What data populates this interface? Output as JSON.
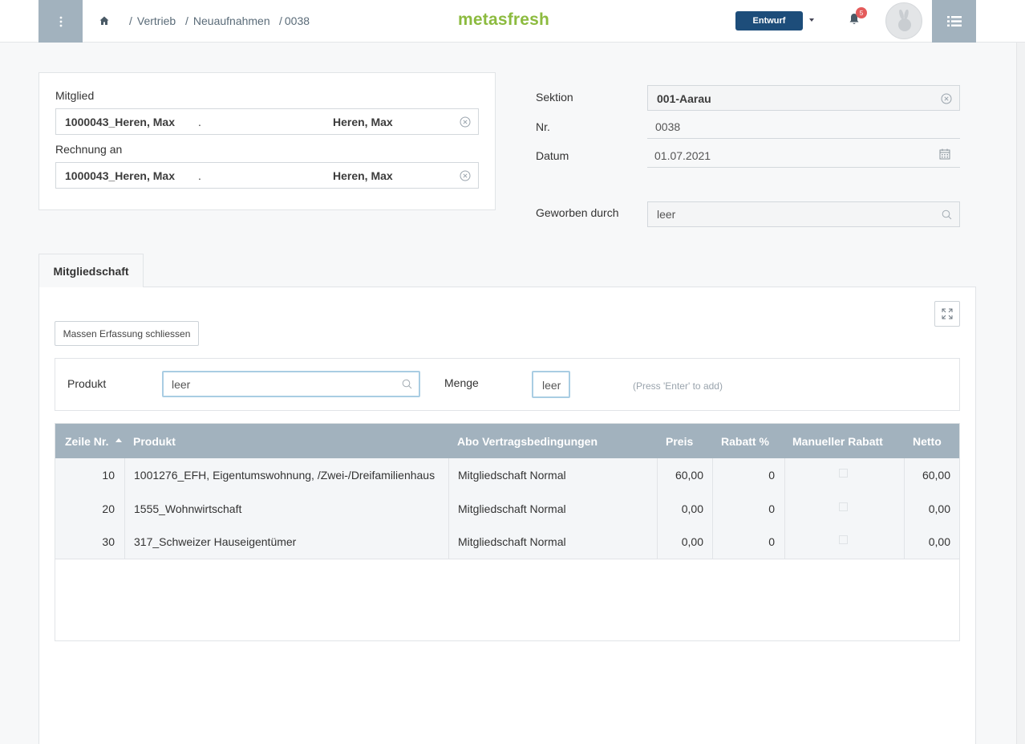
{
  "header": {
    "menu_icon": "vertical-ellipsis-icon",
    "breadcrumb": [
      {
        "sep": "/",
        "label": "Vertrieb"
      },
      {
        "sep": "/",
        "label": "Neuaufnahmen"
      },
      {
        "sep": "/",
        "label": "0038"
      }
    ],
    "logo": "metasfresh",
    "status_label": "Entwurf",
    "notifications_count": "5"
  },
  "left_panel": {
    "mitglied_label": "Mitglied",
    "mitglied_value": "1000043_Heren, Max",
    "mitglied_dot": ".",
    "mitglied_name": "Heren, Max",
    "rechnung_label": "Rechnung an",
    "rechnung_value": "1000043_Heren, Max",
    "rechnung_dot": ".",
    "rechnung_name": "Heren, Max"
  },
  "right_panel": {
    "sektion_label": "Sektion",
    "sektion_value": "001-Aarau",
    "nr_label": "Nr.",
    "nr_value": "0038",
    "datum_label": "Datum",
    "datum_value": "01.07.2021",
    "geworben_label": "Geworben durch",
    "geworben_value": "leer"
  },
  "tab": {
    "label": "Mitgliedschaft"
  },
  "toolbar": {
    "mass_button_label": "Massen Erfassung schliessen"
  },
  "quick_add": {
    "produkt_label": "Produkt",
    "produkt_placeholder": "leer",
    "menge_label": "Menge",
    "menge_placeholder": "leer",
    "hint": "(Press 'Enter' to add)"
  },
  "table": {
    "columns": [
      "Zeile Nr.",
      "Produkt",
      "Abo Vertragsbedingungen",
      "Preis",
      "Rabatt %",
      "Manueller Rabatt",
      "Netto"
    ],
    "sort_column": "Zeile Nr.",
    "rows": [
      {
        "nr": "10",
        "produkt": "1001276_EFH, Eigentumswohnung, /Zwei-/Dreifamilienhaus",
        "abo": "Mitgliedschaft Normal",
        "preis": "60,00",
        "rabatt": "0",
        "netto": "60,00"
      },
      {
        "nr": "20",
        "produkt": "1555_Wohnwirtschaft",
        "abo": "Mitgliedschaft Normal",
        "preis": "0,00",
        "rabatt": "0",
        "netto": "0,00"
      },
      {
        "nr": "30",
        "produkt": "317_Schweizer Hauseigentümer",
        "abo": "Mitgliedschaft Normal",
        "preis": "0,00",
        "rabatt": "0",
        "netto": "0,00"
      }
    ]
  }
}
